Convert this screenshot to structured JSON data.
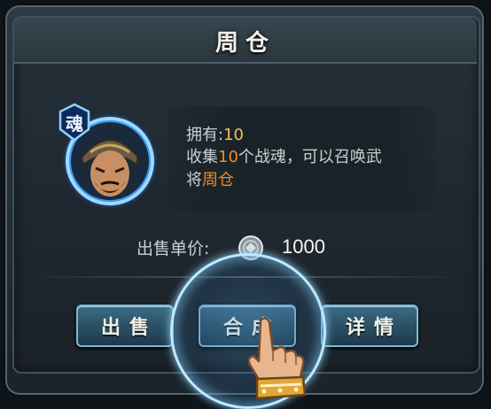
{
  "dialog": {
    "title": "周仓"
  },
  "hero": {
    "soul_badge": "魂",
    "own_label": "拥有:",
    "own_count": "10",
    "desc_prefix": "收集",
    "desc_count": "10",
    "desc_middle": "个战魂，可以召唤武",
    "desc_line2_prefix": "将",
    "desc_hero_name": "周仓"
  },
  "price": {
    "label": "出售单价:",
    "value": "1000",
    "currency_icon": "silver-coin-icon"
  },
  "buttons": {
    "sell": "出售",
    "combine": "合成",
    "details": "详情"
  },
  "colors": {
    "highlight_gold": "#f2c24a",
    "highlight_orange": "#f08a2c",
    "button_blue": "#2a4e63",
    "glow_blue": "#8fd3ff"
  }
}
